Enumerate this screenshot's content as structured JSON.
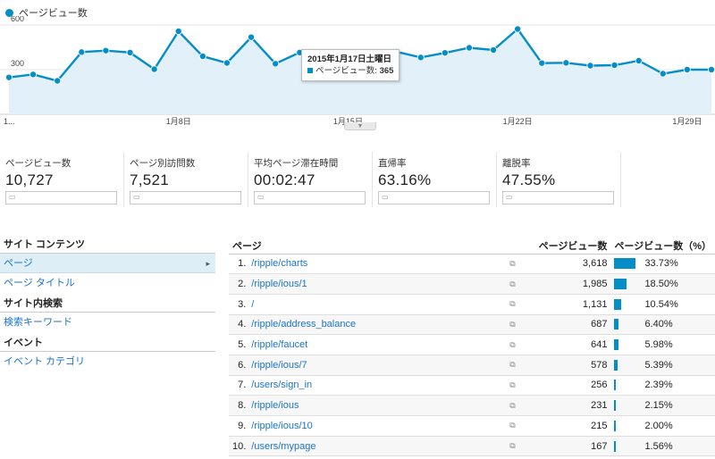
{
  "legend": {
    "label": "ページビュー数",
    "color": "#058dc7"
  },
  "chart_data": {
    "type": "area",
    "series": [
      {
        "name": "ページビュー数",
        "values": [
          248,
          268,
          225,
          418,
          428,
          415,
          303,
          558,
          390,
          345,
          518,
          340,
          415,
          365,
          380,
          395,
          420,
          382,
          413,
          447,
          432,
          573,
          344,
          346,
          327,
          330,
          360,
          273,
          300,
          300
        ]
      }
    ],
    "yticks": [
      300,
      600
    ],
    "ylim": [
      0,
      660
    ],
    "xticks": [
      {
        "index": 0,
        "label": "1..."
      },
      {
        "index": 7,
        "label": "1月8日"
      },
      {
        "index": 14,
        "label": "1月15日"
      },
      {
        "index": 21,
        "label": "1月22日"
      },
      {
        "index": 28,
        "label": "1月29日"
      }
    ],
    "color": "#058dc7",
    "fill": "#e2f1f9",
    "grid": true
  },
  "tooltip": {
    "date": "2015年1月17日土曜日",
    "label": "ページビュー数: ",
    "value": "365"
  },
  "metrics": [
    {
      "label": "ページビュー数",
      "value": "10,727"
    },
    {
      "label": "ページ別訪問数",
      "value": "7,521"
    },
    {
      "label": "平均ページ滞在時間",
      "value": "00:02:47"
    },
    {
      "label": "直帰率",
      "value": "63.16%"
    },
    {
      "label": "離脱率",
      "value": "47.55%"
    }
  ],
  "leftnav": {
    "site_content": "サイト コンテンツ",
    "page": "ページ",
    "page_title": "ページ タイトル",
    "site_search": "サイト内検索",
    "search_keyword": "検索キーワード",
    "events": "イベント",
    "event_category": "イベント カテゴリ"
  },
  "table": {
    "headers": {
      "page": "ページ",
      "pv": "ページビュー数",
      "pct": "ページビュー数（%）"
    },
    "rows": [
      {
        "idx": "1.",
        "page": "/ripple/charts",
        "pv": "3,618",
        "pct": "33.73%",
        "ratio": 0.3373
      },
      {
        "idx": "2.",
        "page": "/ripple/ious/1",
        "pv": "1,985",
        "pct": "18.50%",
        "ratio": 0.185
      },
      {
        "idx": "3.",
        "page": "/",
        "pv": "1,131",
        "pct": "10.54%",
        "ratio": 0.1054
      },
      {
        "idx": "4.",
        "page": "/ripple/address_balance",
        "pv": "687",
        "pct": "6.40%",
        "ratio": 0.064
      },
      {
        "idx": "5.",
        "page": "/ripple/faucet",
        "pv": "641",
        "pct": "5.98%",
        "ratio": 0.0598
      },
      {
        "idx": "6.",
        "page": "/ripple/ious/7",
        "pv": "578",
        "pct": "5.39%",
        "ratio": 0.0539
      },
      {
        "idx": "7.",
        "page": "/users/sign_in",
        "pv": "256",
        "pct": "2.39%",
        "ratio": 0.0239
      },
      {
        "idx": "8.",
        "page": "/ripple/ious",
        "pv": "231",
        "pct": "2.15%",
        "ratio": 0.0215
      },
      {
        "idx": "9.",
        "page": "/ripple/ious/10",
        "pv": "215",
        "pct": "2.00%",
        "ratio": 0.02
      },
      {
        "idx": "10.",
        "page": "/users/mypage",
        "pv": "167",
        "pct": "1.56%",
        "ratio": 0.0156
      }
    ]
  }
}
